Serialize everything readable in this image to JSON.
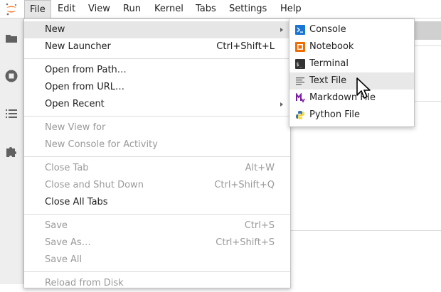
{
  "menubar": {
    "items": [
      "File",
      "Edit",
      "View",
      "Run",
      "Kernel",
      "Tabs",
      "Settings",
      "Help"
    ]
  },
  "sidebar": {
    "icons": [
      "folder-icon",
      "running-icon",
      "toc-icon",
      "extension-icon"
    ]
  },
  "file_menu": {
    "new": "New",
    "new_launcher": {
      "label": "New Launcher",
      "shortcut": "Ctrl+Shift+L"
    },
    "open_from_path": "Open from Path…",
    "open_from_url": "Open from URL…",
    "open_recent": "Open Recent",
    "new_view_for": "New View for",
    "new_console_for_activity": "New Console for Activity",
    "close_tab": {
      "label": "Close Tab",
      "shortcut": "Alt+W"
    },
    "close_and_shut_down": {
      "label": "Close and Shut Down",
      "shortcut": "Ctrl+Shift+Q"
    },
    "close_all_tabs": "Close All Tabs",
    "save": {
      "label": "Save",
      "shortcut": "Ctrl+S"
    },
    "save_as": {
      "label": "Save As…",
      "shortcut": "Ctrl+Shift+S"
    },
    "save_all": "Save All",
    "reload_from_disk": "Reload from Disk"
  },
  "new_submenu": {
    "items": [
      {
        "label": "Console",
        "icon": "console-icon"
      },
      {
        "label": "Notebook",
        "icon": "notebook-icon"
      },
      {
        "label": "Terminal",
        "icon": "terminal-icon"
      },
      {
        "label": "Text File",
        "icon": "text-file-icon"
      },
      {
        "label": "Markdown File",
        "icon": "markdown-icon"
      },
      {
        "label": "Python File",
        "icon": "python-icon"
      }
    ]
  },
  "colors": {
    "accent_orange": "#f37726",
    "console_blue": "#1976d2",
    "notebook_orange": "#ef6c00",
    "terminal_dark": "#333333",
    "markdown_purple": "#7b1fa2",
    "python_blue": "#3776ab",
    "python_yellow": "#ffd43b"
  }
}
